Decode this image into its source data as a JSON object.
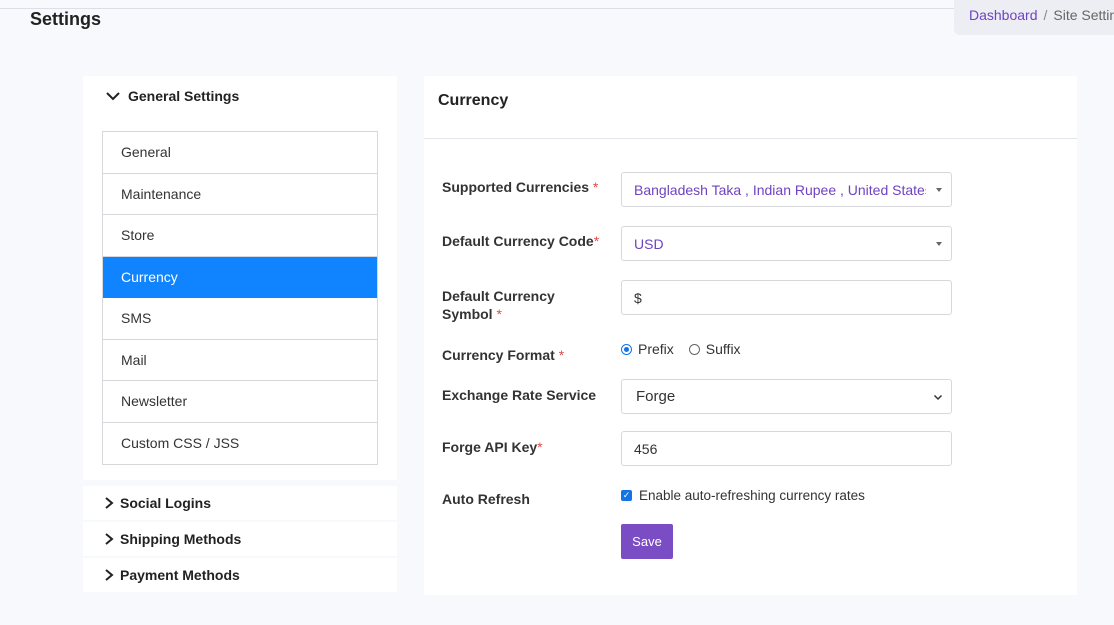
{
  "page": {
    "title": "Settings"
  },
  "breadcrumb": {
    "link": "Dashboard",
    "separator": "/",
    "current": "Site Settings"
  },
  "sidebar": {
    "open_section": {
      "label": "General Settings",
      "icon": "chevron-down-icon"
    },
    "items": [
      {
        "label": "General"
      },
      {
        "label": "Maintenance"
      },
      {
        "label": "Store"
      },
      {
        "label": "Currency",
        "active": true
      },
      {
        "label": "SMS"
      },
      {
        "label": "Mail"
      },
      {
        "label": "Newsletter"
      },
      {
        "label": "Custom CSS / JSS"
      }
    ],
    "closed_sections": [
      {
        "label": "Social Logins",
        "icon": "chevron-right-icon"
      },
      {
        "label": "Shipping Methods",
        "icon": "chevron-right-icon"
      },
      {
        "label": "Payment Methods",
        "icon": "chevron-right-icon"
      }
    ]
  },
  "form": {
    "title": "Currency",
    "required_mark": "*",
    "supported_currencies": {
      "label": "Supported Currencies",
      "value": "Bangladesh Taka , Indian Rupee , United States Dollar"
    },
    "default_currency_code": {
      "label": "Default Currency Code",
      "value": "USD"
    },
    "default_currency_symbol": {
      "label_line1": "Default Currency",
      "label_line2": "Symbol",
      "value": "$"
    },
    "currency_format": {
      "label": "Currency Format",
      "options": [
        "Prefix",
        "Suffix"
      ],
      "selected": "Prefix"
    },
    "exchange_rate_service": {
      "label": "Exchange Rate Service",
      "value": "Forge"
    },
    "forge_api_key": {
      "label": "Forge API Key",
      "value": "456"
    },
    "auto_refresh": {
      "label": "Auto Refresh",
      "checkbox_label": "Enable auto-refreshing currency rates",
      "checked": true
    },
    "save_label": "Save"
  },
  "colors": {
    "accent": "#1084ff",
    "brand_purple": "#7b4dc4",
    "link_purple": "#6f42c1",
    "required_red": "#e04a4a"
  }
}
